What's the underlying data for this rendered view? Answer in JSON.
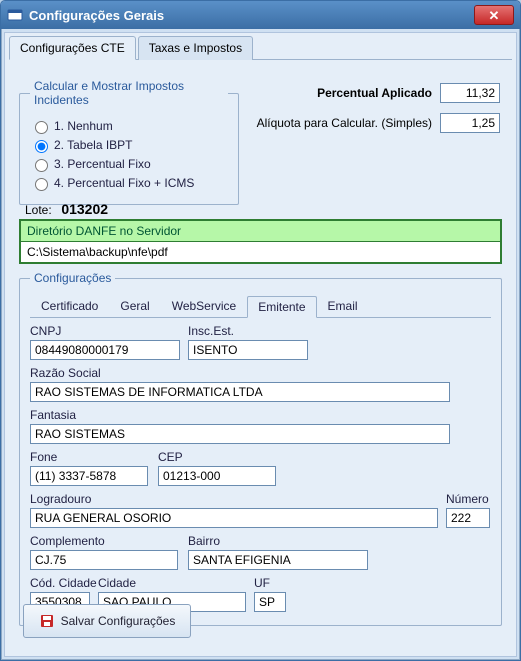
{
  "window": {
    "title": "Configurações Gerais"
  },
  "outer_tabs": [
    {
      "label": "Configurações CTE",
      "active": true
    },
    {
      "label": "Taxas e Impostos",
      "active": false
    }
  ],
  "tax_group": {
    "legend": "Calcular e Mostrar Impostos Incidentes",
    "options": [
      {
        "label": "1. Nenhum",
        "selected": false
      },
      {
        "label": "2. Tabela IBPT",
        "selected": true
      },
      {
        "label": "3. Percentual Fixo",
        "selected": false
      },
      {
        "label": "4. Percentual Fixo + ICMS",
        "selected": false
      }
    ]
  },
  "right": {
    "percentual_label": "Percentual Aplicado",
    "percentual_value": "11,32",
    "aliquota_label": "Alíquota para Calcular. (Simples)",
    "aliquota_value": "1,25"
  },
  "lote": {
    "label": "Lote:",
    "value": "013202"
  },
  "danfe": {
    "header": "Diretório DANFE no Servidor",
    "path": "C:\\Sistema\\backup\\nfe\\pdf"
  },
  "config_group": {
    "legend": "Configurações",
    "tabs": [
      {
        "label": "Certificado"
      },
      {
        "label": "Geral"
      },
      {
        "label": "WebService"
      },
      {
        "label": "Emitente"
      },
      {
        "label": "Email"
      }
    ],
    "active_tab_index": 3
  },
  "emitente": {
    "cnpj_label": "CNPJ",
    "cnpj": "08449080000179",
    "insc_label": "Insc.Est.",
    "insc": "ISENTO",
    "razao_label": "Razão Social",
    "razao": "RAO SISTEMAS DE INFORMATICA LTDA",
    "fantasia_label": "Fantasia",
    "fantasia": "RAO SISTEMAS",
    "fone_label": "Fone",
    "fone": "(11) 3337-5878",
    "cep_label": "CEP",
    "cep": "01213-000",
    "logradouro_label": "Logradouro",
    "logradouro": "RUA GENERAL OSORIO",
    "numero_label": "Número",
    "numero": "222",
    "complemento_label": "Complemento",
    "complemento": "CJ.75",
    "bairro_label": "Bairro",
    "bairro": "SANTA EFIGENIA",
    "codcidade_label": "Cód. Cidade",
    "codcidade": "3550308",
    "cidade_label": "Cidade",
    "cidade": "SAO PAULO",
    "uf_label": "UF",
    "uf": "SP"
  },
  "save_button": "Salvar Configurações"
}
